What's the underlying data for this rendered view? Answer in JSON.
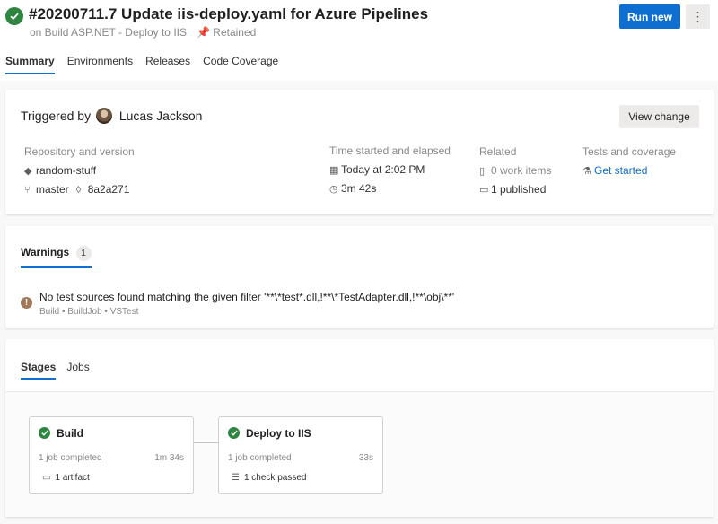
{
  "header": {
    "title": "#20200711.7 Update iis-deploy.yaml for Azure Pipelines",
    "subtitle": "on Build ASP.NET - Deploy to IIS",
    "retained": "Retained",
    "run_new": "Run new",
    "more": "⋮"
  },
  "tabs": [
    "Summary",
    "Environments",
    "Releases",
    "Code Coverage"
  ],
  "summary": {
    "triggered_by": "Triggered by",
    "user": "Lucas Jackson",
    "view_change": "View change",
    "repository": {
      "heading": "Repository and version",
      "repo": "random-stuff",
      "branch": "master",
      "commit": "8a2a271"
    },
    "time": {
      "heading": "Time started and elapsed",
      "started": "Today at 2:02 PM",
      "elapsed": "3m 42s"
    },
    "related": {
      "heading": "Related",
      "work_items": "0 work items",
      "published": "1 published"
    },
    "tests": {
      "heading": "Tests and coverage",
      "link": "Get started"
    }
  },
  "warnings": {
    "tab": "Warnings",
    "count": "1",
    "message": "No test sources found matching the given filter '**\\*test*.dll,!**\\*TestAdapter.dll,!**\\obj\\**'",
    "source": "Build • BuildJob • VSTest"
  },
  "stages": {
    "tabs": [
      "Stages",
      "Jobs"
    ],
    "items": [
      {
        "name": "Build",
        "jobs": "1 job completed",
        "time": "1m 34s",
        "extra": "1 artifact"
      },
      {
        "name": "Deploy to IIS",
        "jobs": "1 job completed",
        "time": "33s",
        "extra": "1 check passed"
      }
    ]
  },
  "colors": {
    "accent": "#0f6fd1",
    "success": "#2e8540",
    "warning": "#a1785a"
  }
}
